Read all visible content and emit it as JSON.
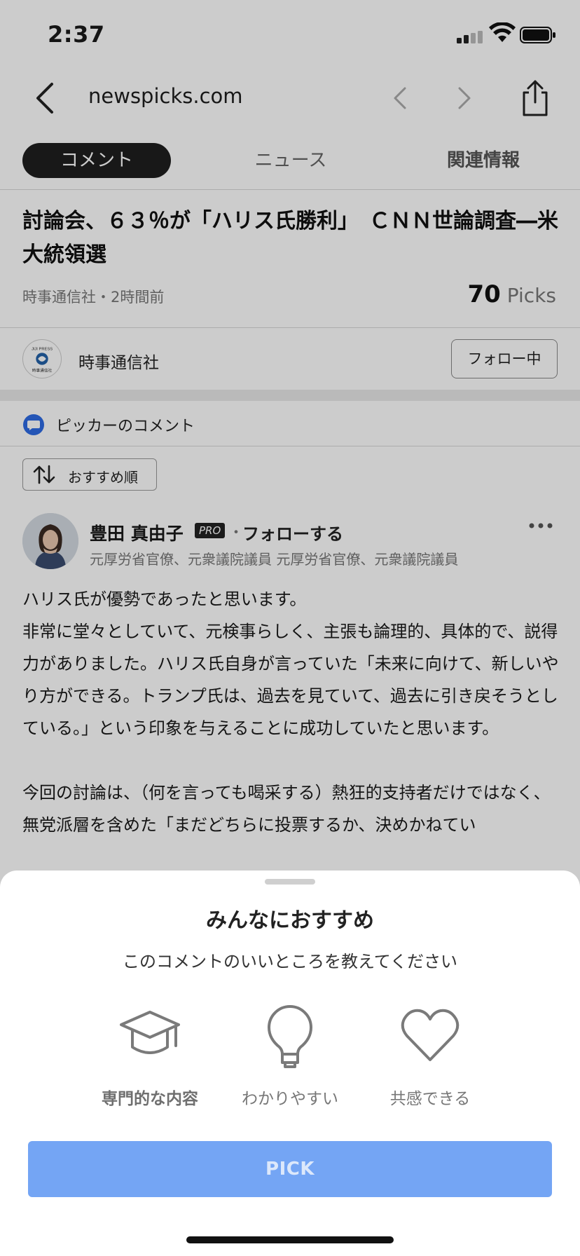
{
  "status_bar": {
    "time": "2:37"
  },
  "nav": {
    "url": "newspicks.com"
  },
  "tabs": [
    {
      "label": "コメント",
      "active": true
    },
    {
      "label": "ニュース",
      "active": false
    },
    {
      "label": "関連情報",
      "active": false
    }
  ],
  "article": {
    "headline": "討論会、６３％が「ハリス氏勝利」　ＣＮＮ世論調査―米大統領選",
    "source_time": "時事通信社・2時間前",
    "picks_count": "70",
    "picks_label": "Picks"
  },
  "publisher": {
    "name": "時事通信社",
    "follow_label": "フォロー中",
    "logo_text_top": "JIJI PRESS",
    "logo_text_bottom": "時事通信社"
  },
  "comments_section": {
    "title": "ピッカーのコメント",
    "sort_label": "おすすめ順"
  },
  "comment": {
    "author": "豊田 真由子",
    "badge": "PRO",
    "separator": "・",
    "follow_label": "フォローする",
    "author_title": "元厚労省官僚、元衆議院議員 元厚労省官僚、元衆議院議員",
    "paragraph1": "ハリス氏が優勢であったと思います。\n非常に堂々としていて、元検事らしく、主張も論理的、具体的で、説得力がありました。ハリス氏自身が言っていた「未来に向けて、新しいやり方ができる。トランプ氏は、過去を見ていて、過去に引き戻そうとしている。」という印象を与えることに成功していたと思います。",
    "paragraph2": "今回の討論は、（何を言っても喝采する）熱狂的支持者だけではなく、無党派層を含めた「まだどちらに投票するか、決めかねてい"
  },
  "sheet": {
    "title": "みんなにおすすめ",
    "subtitle": "このコメントのいいところを教えてください",
    "options": [
      {
        "label": "専門的な内容",
        "icon": "graduation-cap-icon"
      },
      {
        "label": "わかりやすい",
        "icon": "lightbulb-icon"
      },
      {
        "label": "共感できる",
        "icon": "heart-icon"
      }
    ],
    "pick_label": "PICK"
  },
  "colors": {
    "pick_button": "#74a5f4",
    "active_tab": "#1e1e1e",
    "comment_icon": "#2d6be4"
  }
}
